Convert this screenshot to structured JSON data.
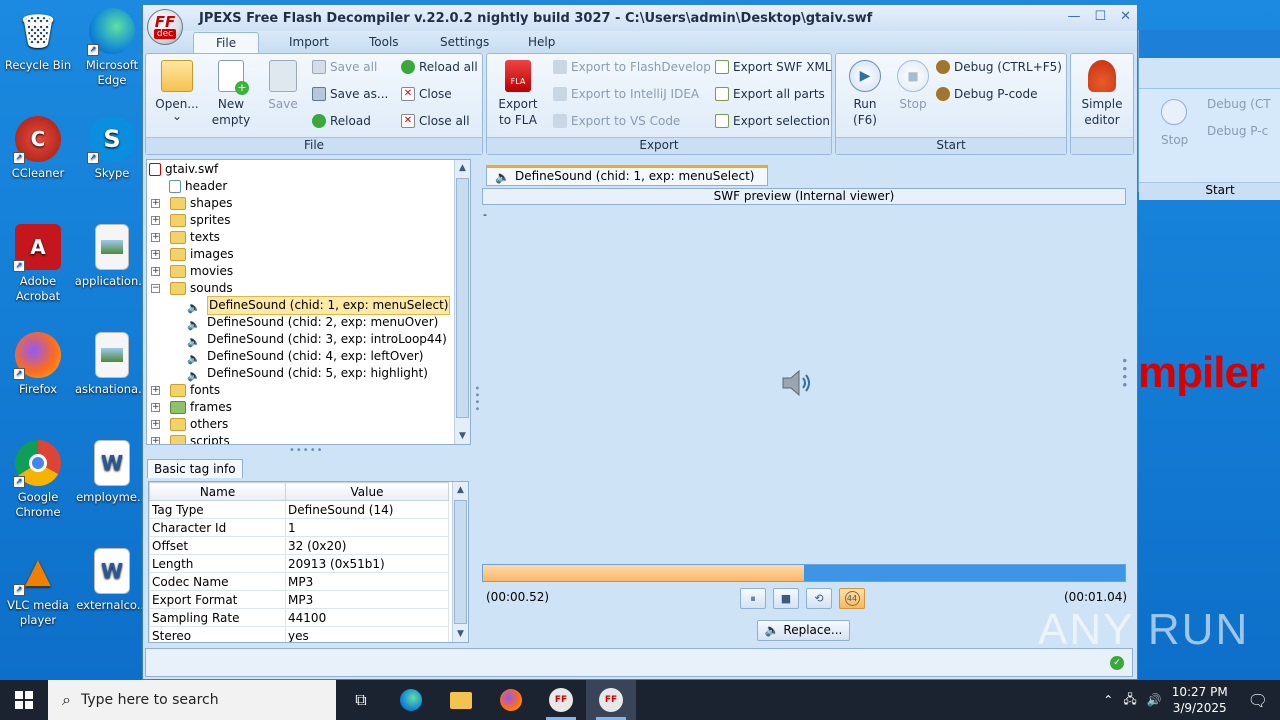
{
  "window": {
    "title": "JPEXS Free Flash Decompiler v.22.0.2 nightly build 3027 - C:\\Users\\admin\\Desktop\\gtaiv.swf",
    "controls": {
      "minimize": "—",
      "maximize": "☐",
      "close": "✕"
    },
    "logo": {
      "line1": "FF",
      "line2": "dec"
    }
  },
  "menu": [
    "File",
    "Import",
    "Tools",
    "Settings",
    "Help"
  ],
  "ribbon": {
    "file": {
      "label": "File",
      "open": "Open...",
      "open_arrow": "⌄",
      "new_empty": "New\nempty",
      "save": "Save",
      "save_all": "Save all",
      "save_as": "Save as...",
      "reload": "Reload",
      "reload_all": "Reload all",
      "close": "Close",
      "close_all": "Close all"
    },
    "export": {
      "label": "Export",
      "export_fla": "Export\nto FLA",
      "to_flashdevelop": "Export to FlashDevelop",
      "to_intellij": "Export to IntelliJ IDEA",
      "to_vscode": "Export to VS Code",
      "swf_xml": "Export SWF XML",
      "all_parts": "Export all parts",
      "selection": "Export selection"
    },
    "start": {
      "label": "Start",
      "run": "Run\n(F6)",
      "stop": "Stop",
      "debug": "Debug (CTRL+F5)",
      "debug_pcode": "Debug P-code"
    },
    "simple_editor": "Simple\neditor"
  },
  "tree": {
    "root": "gtaiv.swf",
    "items": [
      {
        "label": "header",
        "expandable": false
      },
      {
        "label": "shapes",
        "expandable": true
      },
      {
        "label": "sprites",
        "expandable": true
      },
      {
        "label": "texts",
        "expandable": true
      },
      {
        "label": "images",
        "expandable": true
      },
      {
        "label": "movies",
        "expandable": true
      },
      {
        "label": "sounds",
        "expandable": true,
        "expanded": true
      }
    ],
    "sounds": [
      "DefineSound (chid: 1, exp: menuSelect)",
      "DefineSound (chid: 2, exp: menuOver)",
      "DefineSound (chid: 3, exp: introLoop44)",
      "DefineSound (chid: 4, exp: leftOver)",
      "DefineSound (chid: 5, exp: highlight)"
    ],
    "after": [
      "fonts",
      "frames",
      "others",
      "scripts"
    ]
  },
  "info": {
    "tab": "Basic tag info",
    "headers": [
      "Name",
      "Value"
    ],
    "rows": [
      [
        "Tag Type",
        "DefineSound (14)"
      ],
      [
        "Character Id",
        "1"
      ],
      [
        "Offset",
        "32 (0x20)"
      ],
      [
        "Length",
        "20913 (0x51b1)"
      ],
      [
        "Codec Name",
        "MP3"
      ],
      [
        "Export Format",
        "MP3"
      ],
      [
        "Sampling Rate",
        "44100"
      ],
      [
        "Stereo",
        "yes"
      ]
    ]
  },
  "preview": {
    "tab": "DefineSound (chid: 1, exp: menuSelect)",
    "header": "SWF preview (Internal viewer)",
    "dash": "-",
    "progress": 0.5,
    "time_current": "(00:00.52)",
    "time_total": "(00:01.04)",
    "replace": "Replace...",
    "loop_label": "44"
  },
  "desktop_icons": [
    "Recycle Bin",
    "Microsoft Edge",
    "CCleaner",
    "Skype",
    "Adobe Acrobat",
    "application...",
    "Firefox",
    "asknationa...",
    "Google Chrome",
    "employme...",
    "VLC media player",
    "externalco..."
  ],
  "background_window": {
    "stop": "Stop",
    "debug": "Debug (CT",
    "debug_pcode": "Debug P-c",
    "start": "Start",
    "red_text": "mpiler"
  },
  "watermark": "ANY RUN",
  "taskbar": {
    "search_placeholder": "Type here to search",
    "time": "10:27 PM",
    "date": "3/9/2025"
  }
}
